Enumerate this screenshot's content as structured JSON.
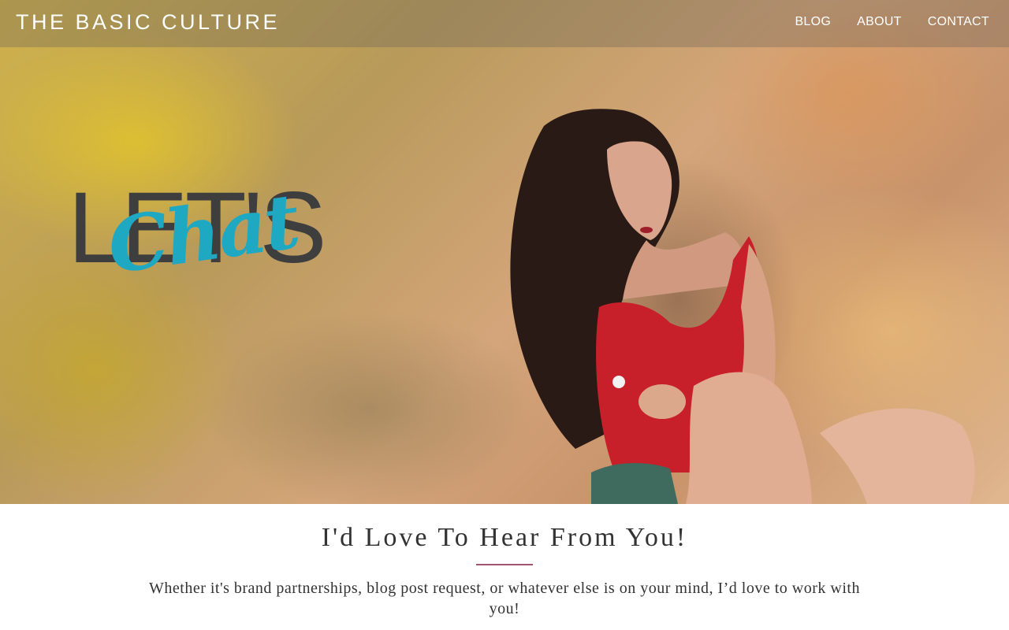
{
  "header": {
    "brand": "THE BASIC CULTURE",
    "nav": [
      {
        "label": "BLOG"
      },
      {
        "label": "ABOUT"
      },
      {
        "label": "CONTACT"
      }
    ]
  },
  "hero": {
    "overlay_main": "LET'S",
    "overlay_script": "Chat"
  },
  "main": {
    "heading": "I'd Love To Hear From You!",
    "body": "Whether it's brand partnerships, blog post request, or whatever else is on your mind, I’d love to work with you!"
  },
  "colors": {
    "accent_divider": "#a0546e",
    "script_teal": "#1ea8c2"
  }
}
